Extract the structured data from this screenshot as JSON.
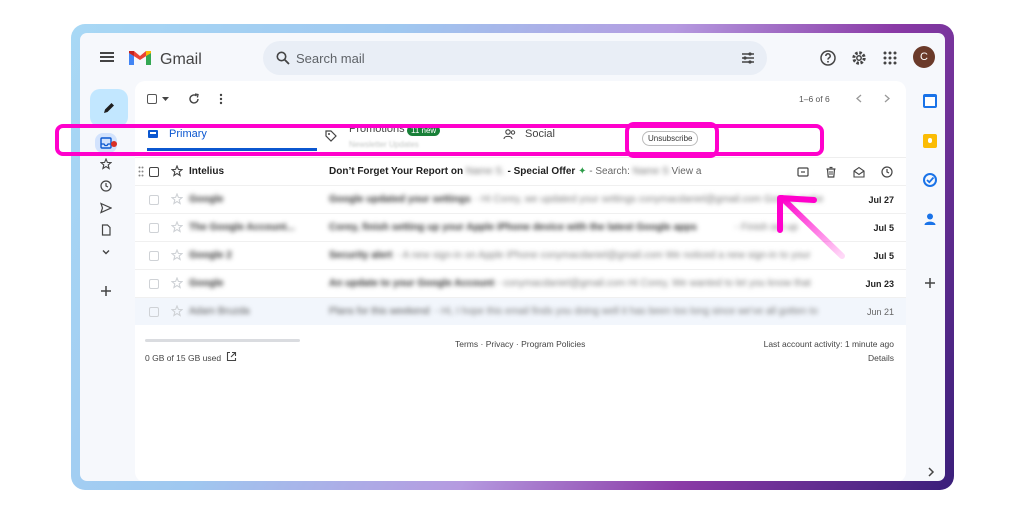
{
  "header": {
    "brand": "Gmail",
    "search_placeholder": "Search mail",
    "avatar_letter": "C"
  },
  "toolbar": {
    "pagination": "1–6 of 6"
  },
  "tabs": [
    {
      "label": "Primary"
    },
    {
      "label": "Promotions",
      "badge": "11 new",
      "sub": "Newsletter Updates"
    },
    {
      "label": "Social"
    }
  ],
  "emails": [
    {
      "sender": "Intelius",
      "subject": "Don’t Forget Your Report on",
      "subject_blur": "Name S.",
      "subject_tail": " - Special Offer",
      "snippet": " - Search:",
      "snippet_blur": "Name S",
      "snippet_tail": "View a",
      "unsubscribe": "Unsubscribe"
    },
    {
      "sender": "Google",
      "subject": "Google updated your settings",
      "snippet": " - Hi Corey, we updated your settings conymacdaniel@gmail.com Google make",
      "date": "Jul 27"
    },
    {
      "sender": "The Google Account...",
      "subject": "Corey, finish setting up your Apple iPhone device with the latest Google apps",
      "snippet": " - Finish set up",
      "date": "Jul 5"
    },
    {
      "sender": "Google 2",
      "subject": "Security alert",
      "snippet": " - A new sign-in on Apple iPhone conymacdaniel@gmail.com We noticed a new sign-in to your",
      "date": "Jul 5"
    },
    {
      "sender": "Google",
      "subject": "An update to your Google Account",
      "snippet": " - conymacdaniel@gmail.com Hi Corey, We wanted to let you know that",
      "date": "Jun 23"
    },
    {
      "sender": "Adam Bruzda",
      "subject": "Plans for this weekend",
      "snippet": " - Hi, I hope this email finds you doing well it has been too long since we've all gotten to",
      "date": "Jun 21"
    }
  ],
  "footer": {
    "storage": "0 GB of 15 GB used",
    "links": "Terms · Privacy · Program Policies",
    "activity": "Last account activity: 1 minute ago",
    "details": "Details"
  },
  "colors": {
    "accent": "#0b57d0",
    "highlight": "#ff00cc",
    "badge": "#188038"
  }
}
